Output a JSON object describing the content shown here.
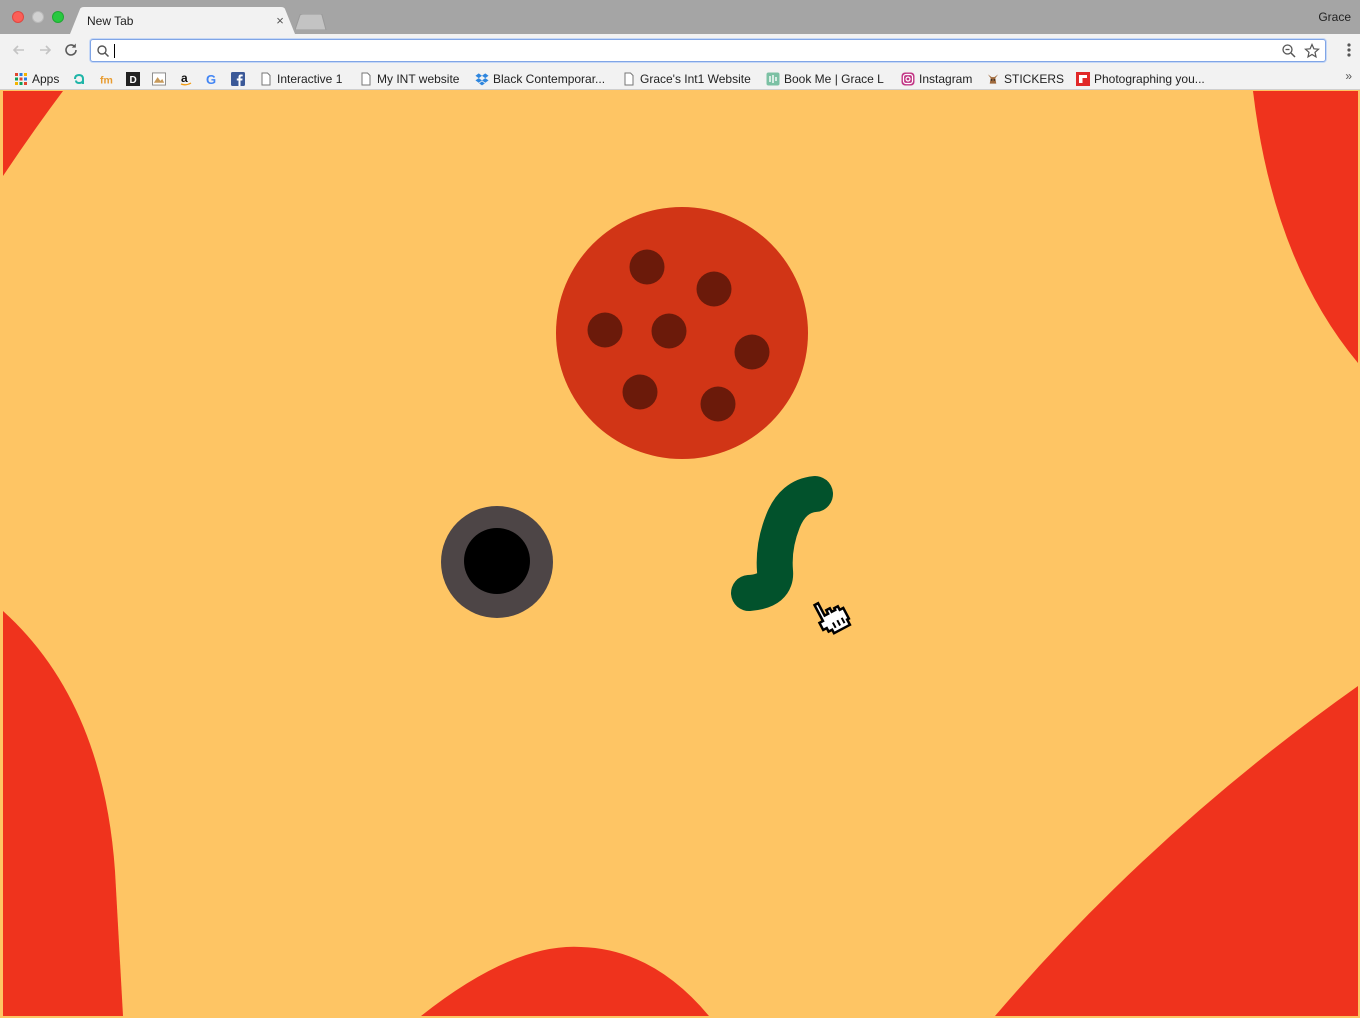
{
  "window": {
    "profile_name": "Grace"
  },
  "tab": {
    "title": "New Tab",
    "close_glyph": "×"
  },
  "toolbar": {
    "url_value": "",
    "back_icon": "arrow-left-icon",
    "forward_icon": "arrow-right-icon",
    "reload_icon": "reload-icon",
    "zoom_icon": "zoom-out-icon",
    "star_icon": "star-icon",
    "menu_icon": "more-vertical-icon"
  },
  "bookmarks": {
    "items": [
      {
        "label": "Apps",
        "icon": "apps-grid-icon"
      },
      {
        "label": "",
        "icon": "a-logo-icon"
      },
      {
        "label": "",
        "icon": "fm-logo-icon"
      },
      {
        "label": "",
        "icon": "d-logo-icon"
      },
      {
        "label": "",
        "icon": "picture-icon"
      },
      {
        "label": "",
        "icon": "amazon-icon"
      },
      {
        "label": "",
        "icon": "google-icon"
      },
      {
        "label": "",
        "icon": "facebook-icon"
      },
      {
        "label": "Interactive 1",
        "icon": "page-icon"
      },
      {
        "label": "My INT website",
        "icon": "page-icon"
      },
      {
        "label": "Black Contemporar...",
        "icon": "dropbox-icon"
      },
      {
        "label": "Grace's Int1 Website",
        "icon": "page-icon"
      },
      {
        "label": "Book Me | Grace L",
        "icon": "calendar-icon"
      },
      {
        "label": "Instagram",
        "icon": "instagram-icon"
      },
      {
        "label": "STICKERS",
        "icon": "sticker-icon"
      },
      {
        "label": "Photographing you...",
        "icon": "flipboard-icon"
      }
    ],
    "more_glyph": "»"
  },
  "colors": {
    "background": "#fec564",
    "blob_red": "#ef331d",
    "pepperoni": "#d13516",
    "pepperoni_spots": "#6b1a0a",
    "olive_ring": "#4d4546",
    "olive_hole": "#000000",
    "pepper_green": "#02522c"
  }
}
